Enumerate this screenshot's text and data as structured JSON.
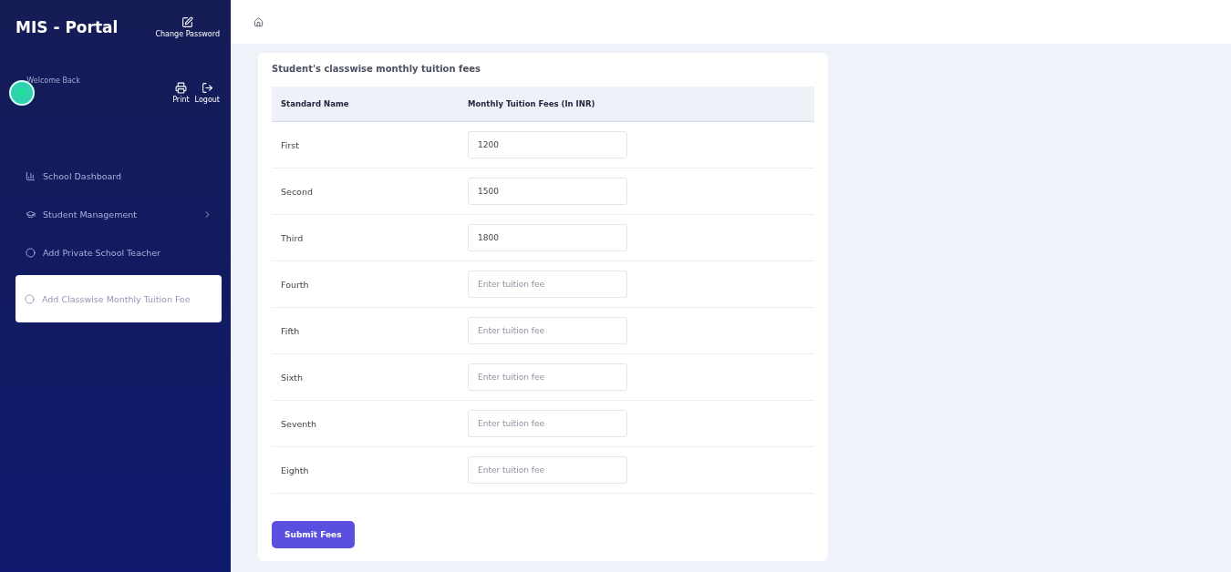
{
  "sidebar": {
    "brand": "MIS - Portal",
    "change_password": "Change Password",
    "welcome": "Welcome Back",
    "actions": [
      {
        "kind": "print",
        "label": "Print"
      },
      {
        "kind": "logout",
        "label": "Logout"
      }
    ],
    "items": [
      {
        "kind": "dashboard",
        "label": "School Dashboard",
        "expandable": false,
        "selected": false
      },
      {
        "kind": "students",
        "label": "Student Management",
        "expandable": true,
        "selected": false
      },
      {
        "kind": "circle",
        "label": "Add Private School Teacher",
        "expandable": false,
        "selected": false
      },
      {
        "kind": "circle",
        "label": "Add Classwise Monthly Tuition Fee",
        "expandable": false,
        "selected": true
      }
    ]
  },
  "card": {
    "title": "Student's classwise monthly tuition fees",
    "columns": [
      "Standard Name",
      "Monthly Tuition Fees (In INR)"
    ],
    "rows": [
      {
        "name": "First",
        "value": "1200"
      },
      {
        "name": "Second",
        "value": "1500"
      },
      {
        "name": "Third",
        "value": "1800"
      },
      {
        "name": "Fourth",
        "placeholder": "Enter tuition fee"
      },
      {
        "name": "Fifth",
        "placeholder": "Enter tuition fee"
      },
      {
        "name": "Sixth",
        "placeholder": "Enter tuition fee"
      },
      {
        "name": "Seventh",
        "placeholder": "Enter tuition fee"
      },
      {
        "name": "Eighth",
        "placeholder": "Enter tuition fee"
      }
    ],
    "submit": "Submit Fees"
  }
}
